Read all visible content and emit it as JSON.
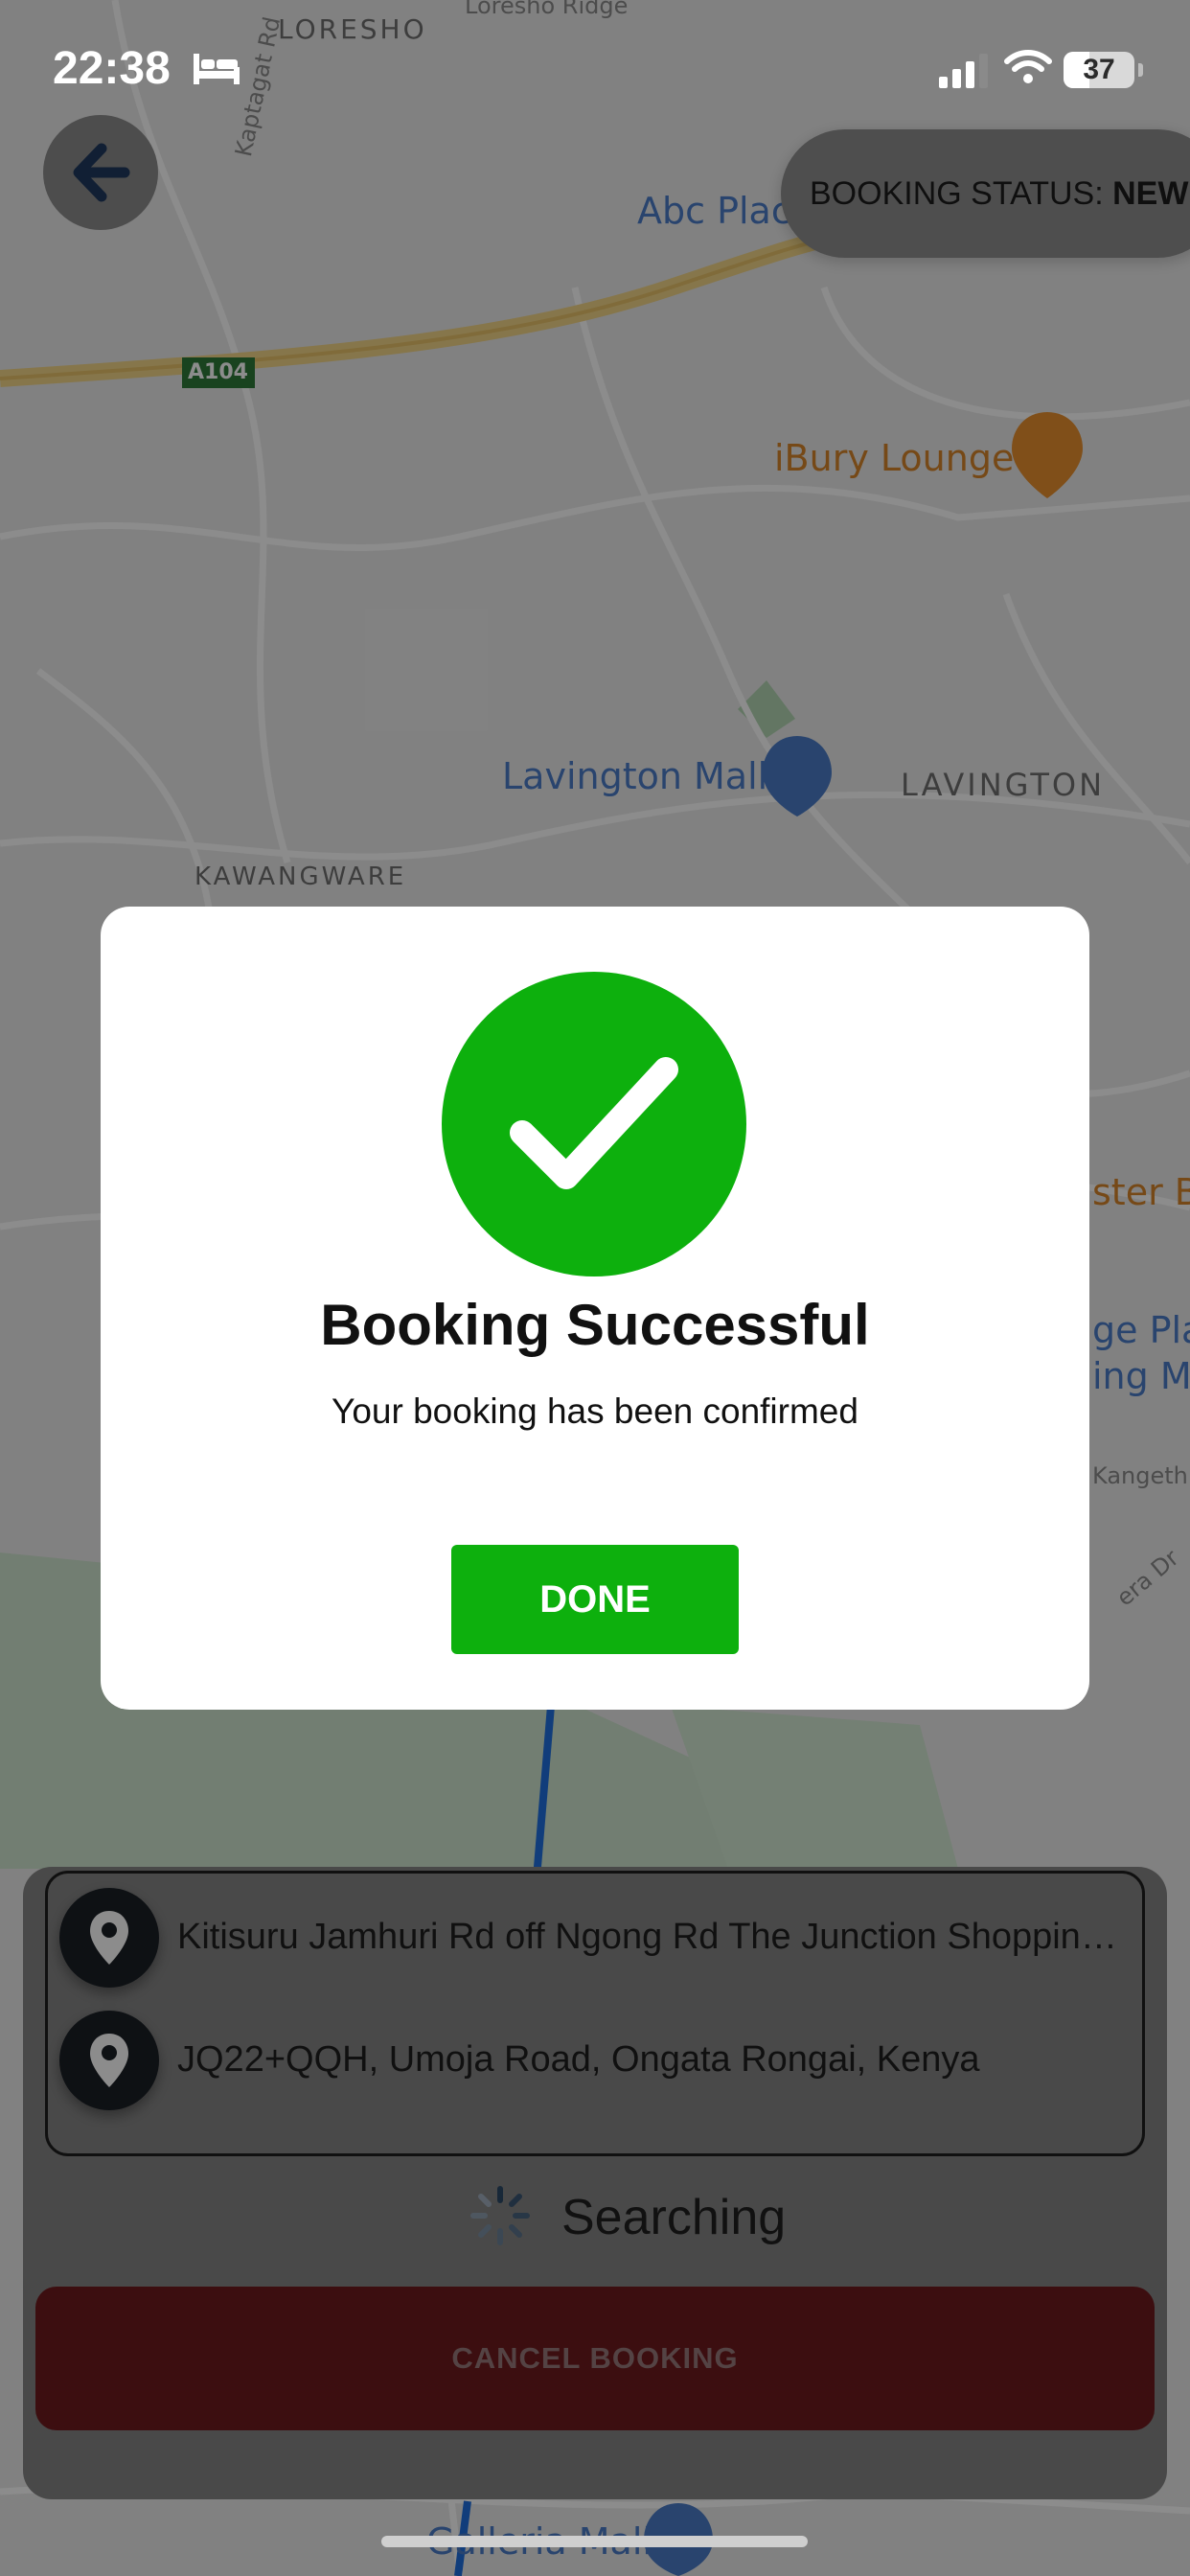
{
  "status_bar": {
    "time": "22:38",
    "battery": "37",
    "battery_level_percent": 37,
    "icons": [
      "bed-icon",
      "cellular-signal-icon",
      "wifi-icon",
      "battery-icon"
    ]
  },
  "map": {
    "area_labels": [
      "LORESHO",
      "LAVINGTON",
      "KAWANGWARE"
    ],
    "place_labels": [
      "Abc Plac",
      "iBury Lounge",
      "Lavington Mall",
      "Galleria Mall",
      "ster Ba",
      "ge Pla",
      "ing M"
    ],
    "road_labels": [
      "Kaptagat Rd",
      "A104",
      "Loresho Ridge",
      "Kangeth",
      "era Dr"
    ]
  },
  "header": {
    "back_icon": "arrow-left-icon",
    "booking_status_label": "BOOKING STATUS:",
    "booking_status_value": "NEW"
  },
  "route": {
    "pickup": "Kitisuru Jamhuri Rd off Ngong Rd The Junction Shopping Mall",
    "dropoff": "JQ22+QQH, Umoja Road, Ongata Rongai, Kenya",
    "pin_icon": "map-pin-icon"
  },
  "search": {
    "label": "Searching"
  },
  "cancel_button": {
    "label": "CANCEL BOOKING"
  },
  "dialog": {
    "icon": "checkmark-icon",
    "title": "Booking Successful",
    "message": "Your booking has been confirmed",
    "done_label": "DONE"
  },
  "colors": {
    "success_green": "#0db00d",
    "cancel_red": "#c8323a",
    "pill_background": "#ffffff"
  }
}
